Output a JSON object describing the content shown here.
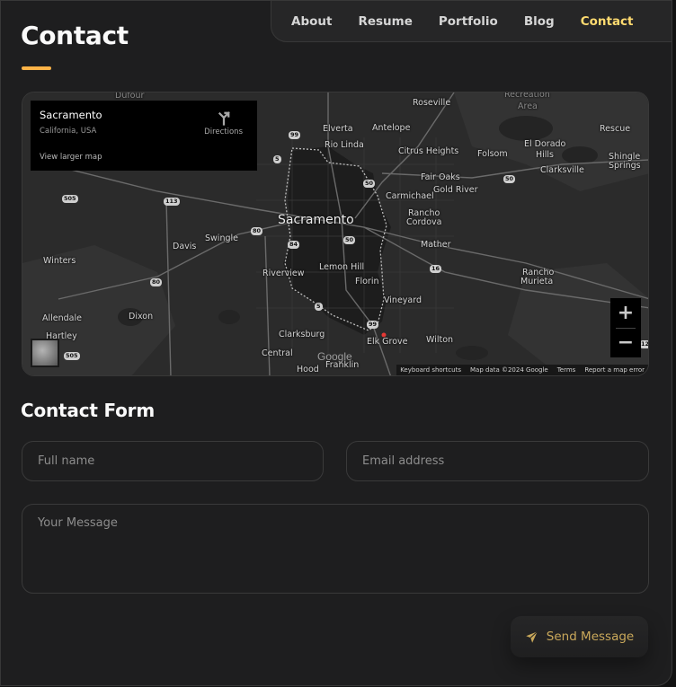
{
  "nav": {
    "items": [
      {
        "label": "About",
        "active": false
      },
      {
        "label": "Resume",
        "active": false
      },
      {
        "label": "Portfolio",
        "active": false
      },
      {
        "label": "Blog",
        "active": false
      },
      {
        "label": "Contact",
        "active": true
      }
    ]
  },
  "page": {
    "title": "Contact"
  },
  "map": {
    "info": {
      "place": "Sacramento",
      "region": "California, USA",
      "directions_label": "Directions",
      "larger_map_label": "View larger map"
    },
    "labels": {
      "sacramento": "Sacramento",
      "dufour": "Dufour",
      "roseville": "Roseville",
      "recreation": "Recreation",
      "area": "Area",
      "rescue": "Rescue",
      "elverta": "Elverta",
      "antelope": "Antelope",
      "rio_linda": "Rio Linda",
      "citrus_heights": "Citrus Heights",
      "folsom": "Folsom",
      "el_dorado": "El Dorado",
      "hills": "Hills",
      "clarksville": "Clarksville",
      "shingle": "Shingle",
      "springs": "Springs",
      "fair_oaks": "Fair Oaks",
      "gold_river": "Gold River",
      "carmichael": "Carmichael",
      "rancho": "Rancho",
      "cordova": "Cordova",
      "mather": "Mather",
      "davis": "Davis",
      "swingle": "Swingle",
      "winters": "Winters",
      "riverview": "Riverview",
      "lemon_hill": "Lemon Hill",
      "florin": "Florin",
      "rancho_murieta_1": "Rancho",
      "murieta": "Murieta",
      "vineyard": "Vineyard",
      "allendale": "Allendale",
      "dixon": "Dixon",
      "hartley": "Hartley",
      "clarksburg": "Clarksburg",
      "elk_grove": "Elk Grove",
      "wilton": "Wilton",
      "central": "Central",
      "hood": "Hood",
      "franklin": "Franklin",
      "google": "Google"
    },
    "shields": [
      "99",
      "50",
      "5",
      "113",
      "505",
      "80",
      "84",
      "50",
      "16",
      "80",
      "5",
      "99",
      "505",
      "50",
      "12"
    ],
    "zoom_in": "+",
    "zoom_out": "−",
    "attribution": {
      "shortcuts": "Keyboard shortcuts",
      "data": "Map data ©2024 Google",
      "terms": "Terms",
      "report": "Report a map error"
    }
  },
  "form": {
    "title": "Contact Form",
    "fullname_placeholder": "Full name",
    "email_placeholder": "Email address",
    "message_placeholder": "Your Message",
    "send_label": "Send Message"
  },
  "colors": {
    "accent": "#ffdb70",
    "background": "#1e1e1f",
    "button_text": "#c9a85a"
  }
}
